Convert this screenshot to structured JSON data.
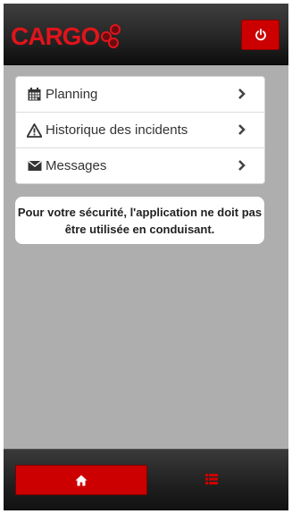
{
  "header": {
    "logo_text": "CARGO",
    "logo_icon": "molecule-dots",
    "power_icon": "power-icon"
  },
  "menu": {
    "items": [
      {
        "label": "Planning",
        "icon": "calendar-icon"
      },
      {
        "label": "Historique des incidents",
        "icon": "warning-icon"
      },
      {
        "label": "Messages",
        "icon": "envelope-icon"
      }
    ]
  },
  "notice": {
    "text": "Pour votre sécurité, l'application ne doit pas être utilisée en conduisant."
  },
  "footer": {
    "tabs": [
      {
        "icon": "home-icon",
        "active": true
      },
      {
        "icon": "list-icon",
        "active": false
      }
    ]
  },
  "colors": {
    "accent": "#cc0000",
    "logo": "#e0141b",
    "background": "#aeaeae"
  }
}
